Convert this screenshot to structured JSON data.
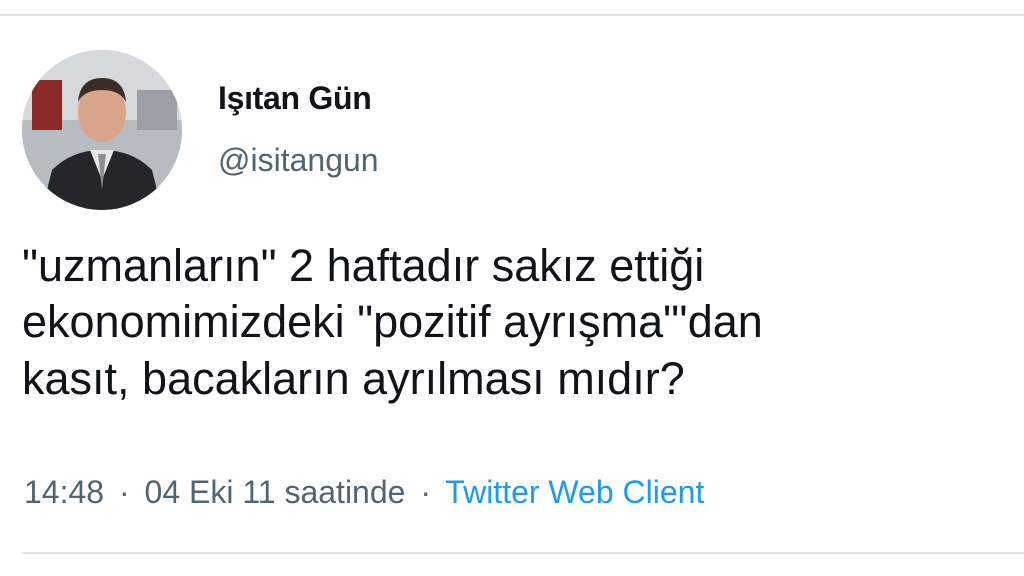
{
  "user": {
    "display_name": "Işıtan Gün",
    "handle": "@isitangun"
  },
  "tweet": {
    "lines": [
      "\"uzmanların\" 2 haftadır sakız ettiği",
      "ekonomimizdeki \"pozitif ayrışma\"'dan",
      "kasıt, bacakların ayrılması mıdır?"
    ]
  },
  "meta": {
    "time": "14:48",
    "separator": "·",
    "date": "04 Eki 11 saatinde",
    "source": "Twitter Web Client"
  },
  "colors": {
    "text_primary": "#0f1419",
    "text_secondary": "#536471",
    "link": "#1d9bf0",
    "divider": "#e6e9ec"
  }
}
